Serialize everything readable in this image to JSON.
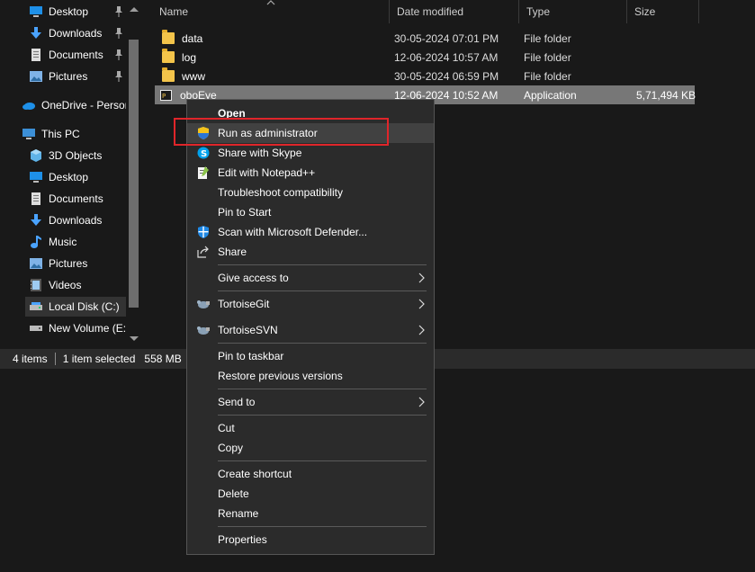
{
  "nav": {
    "quick_access": [
      {
        "label": "Desktop",
        "icon": "desktop-icon",
        "pinned": true
      },
      {
        "label": "Downloads",
        "icon": "download-icon",
        "pinned": true
      },
      {
        "label": "Documents",
        "icon": "document-icon",
        "pinned": true
      },
      {
        "label": "Pictures",
        "icon": "pictures-icon",
        "pinned": true
      }
    ],
    "onedrive": "OneDrive - Person",
    "this_pc": "This PC",
    "pc_items": [
      {
        "label": "3D Objects",
        "icon": "cube-icon"
      },
      {
        "label": "Desktop",
        "icon": "desktop-icon"
      },
      {
        "label": "Documents",
        "icon": "document-icon"
      },
      {
        "label": "Downloads",
        "icon": "download-icon"
      },
      {
        "label": "Music",
        "icon": "music-icon"
      },
      {
        "label": "Pictures",
        "icon": "pictures-icon"
      },
      {
        "label": "Videos",
        "icon": "video-icon"
      },
      {
        "label": "Local Disk (C:)",
        "icon": "drive-icon",
        "selected": true
      },
      {
        "label": "New Volume (E:)",
        "icon": "drive-icon"
      }
    ]
  },
  "columns": {
    "name": "Name",
    "date": "Date modified",
    "type": "Type",
    "size": "Size"
  },
  "files": [
    {
      "name": "data",
      "date": "30-05-2024 07:01 PM",
      "type": "File folder",
      "size": ""
    },
    {
      "name": "log",
      "date": "12-06-2024 10:57 AM",
      "type": "File folder",
      "size": ""
    },
    {
      "name": "www",
      "date": "30-05-2024 06:59 PM",
      "type": "File folder",
      "size": ""
    },
    {
      "name": "oboEye",
      "date": "12-06-2024 10:52 AM",
      "type": "Application",
      "size": "5,71,494 KB"
    }
  ],
  "status": {
    "items": "4 items",
    "selected": "1 item selected",
    "size": "558 MB"
  },
  "menu": {
    "open": "Open",
    "run_admin": "Run as administrator",
    "skype": "Share with Skype",
    "notepad": "Edit with Notepad++",
    "troubleshoot": "Troubleshoot compatibility",
    "pin_start": "Pin to Start",
    "defender": "Scan with Microsoft Defender...",
    "share": "Share",
    "give_access": "Give access to",
    "tortoisegit": "TortoiseGit",
    "tortoisesvn": "TortoiseSVN",
    "pin_taskbar": "Pin to taskbar",
    "restore": "Restore previous versions",
    "send_to": "Send to",
    "cut": "Cut",
    "copy": "Copy",
    "create_shortcut": "Create shortcut",
    "delete": "Delete",
    "rename": "Rename",
    "properties": "Properties"
  },
  "colors": {
    "accent_highlight": "#e0252a",
    "selected_row": "#777777",
    "background": "#191919",
    "menu_bg": "#2b2b2b"
  }
}
